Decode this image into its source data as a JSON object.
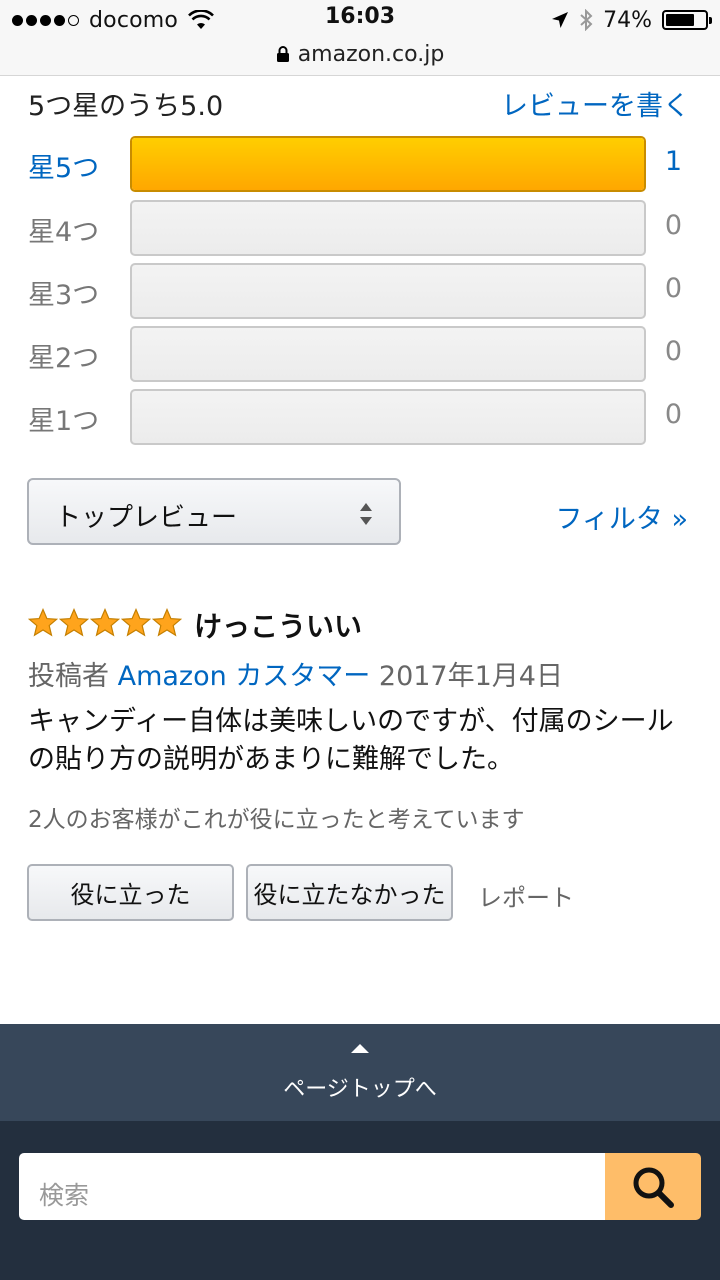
{
  "status_bar": {
    "carrier": "docomo",
    "time": "16:03",
    "battery": "74%",
    "battery_level": 0.74,
    "url": "amazon.co.jp",
    "icons": [
      "signal-dots-icon",
      "wifi-icon",
      "location-arrow-icon",
      "bluetooth-icon",
      "battery-icon",
      "lock-icon"
    ]
  },
  "rating_summary": {
    "average_text": "5つ星のうち5.0",
    "write_review": "レビューを書く",
    "histogram": [
      {
        "label": "星5つ",
        "count": "1",
        "fraction": 1.0,
        "active": true
      },
      {
        "label": "星4つ",
        "count": "0",
        "fraction": 0,
        "active": false
      },
      {
        "label": "星3つ",
        "count": "0",
        "fraction": 0,
        "active": false
      },
      {
        "label": "星2つ",
        "count": "0",
        "fraction": 0,
        "active": false
      },
      {
        "label": "星1つ",
        "count": "0",
        "fraction": 0,
        "active": false
      }
    ]
  },
  "sort": {
    "selected": "トップレビュー",
    "filter_link": "フィルタ »"
  },
  "review": {
    "stars": 5,
    "title": "けっこういい",
    "posted_by_prefix": "投稿者",
    "author": "Amazon カスタマー",
    "date": "2017年1月4日",
    "body": "キャンディー自体は美味しいのですが、付属のシールの貼り方の説明があまりに難解でした。",
    "helpful_count_text": "2人のお客様がこれが役に立ったと考えています",
    "helpful_button": "役に立った",
    "unhelpful_button": "役に立たなかった",
    "report_link": "レポート"
  },
  "footer": {
    "back_to_top": "ページトップへ",
    "search_placeholder": "検索",
    "search_icon": "search-icon"
  },
  "colors": {
    "link": "#0066c0",
    "star_fill": "#ffa41c",
    "footer_top": "#37475a",
    "footer_bottom": "#232f3e",
    "search_button": "#febd69"
  }
}
